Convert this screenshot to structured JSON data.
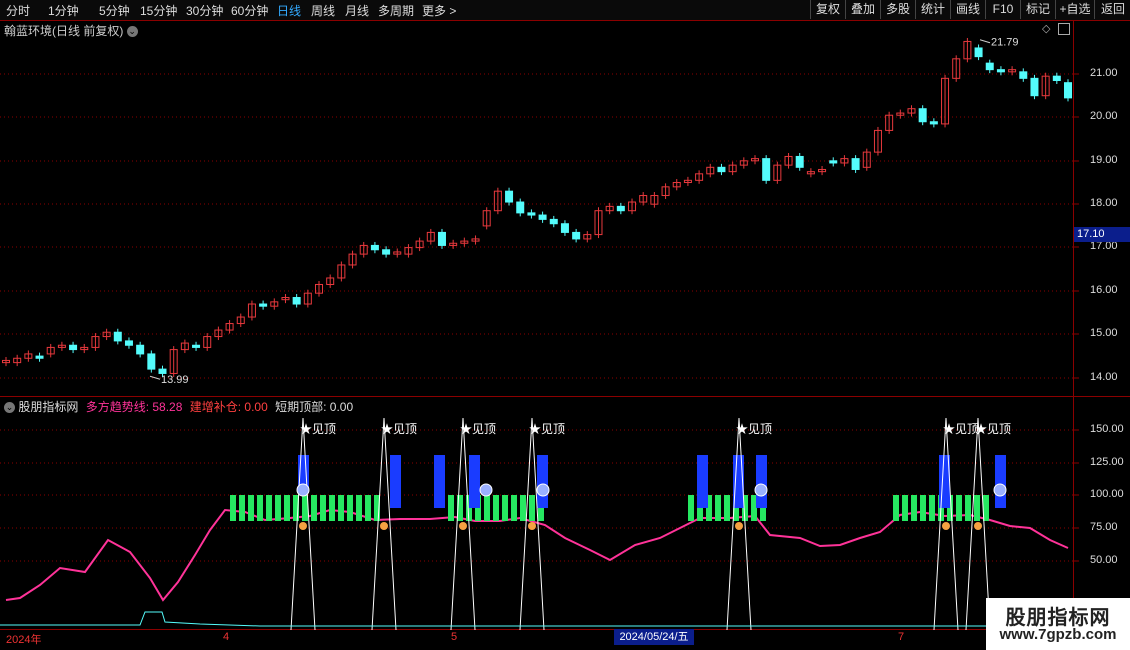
{
  "toolbar": {
    "periods": [
      "分时",
      "1分钟",
      "5分钟",
      "15分钟",
      "30分钟",
      "60分钟",
      "日线",
      "周线",
      "月线",
      "多周期",
      "更多 >"
    ],
    "active_period": "日线",
    "right_buttons": [
      "复权",
      "叠加",
      "多股",
      "统计",
      "画线",
      "F10",
      "标记",
      "+自选",
      "返回"
    ]
  },
  "main_chart": {
    "title": "翰蓝环境(日线 前复权)",
    "high_label": "21.79",
    "low_label": "13.99",
    "current_price": "17.10",
    "y_ticks": [
      "21.00",
      "20.00",
      "19.00",
      "18.00",
      "17.00",
      "16.00",
      "15.00",
      "14.00"
    ]
  },
  "indicator": {
    "name": "股朋指标网",
    "line1": "多方趋势线: 58.28",
    "line2": "建增补仓: 0.00",
    "line3": "短期顶部: 0.00",
    "y_ticks": [
      "150.00",
      "125.00",
      "100.00",
      "75.00",
      "50.00"
    ],
    "signal_label": "★见顶"
  },
  "date_axis": {
    "labels": [
      "2024年",
      "4",
      "5",
      "7"
    ],
    "cursor_date": "2024/05/24/五"
  },
  "watermark": {
    "line1": "股朋指标网",
    "line2": "www.7gpzb.com"
  },
  "colors": {
    "up": "#e8393d",
    "down": "#54fcfc",
    "trend": "#ff3399",
    "bar_green": "#26e861",
    "bar_blue": "#1a3cff",
    "grid": "#8b0000",
    "active": "#33aaff"
  }
}
